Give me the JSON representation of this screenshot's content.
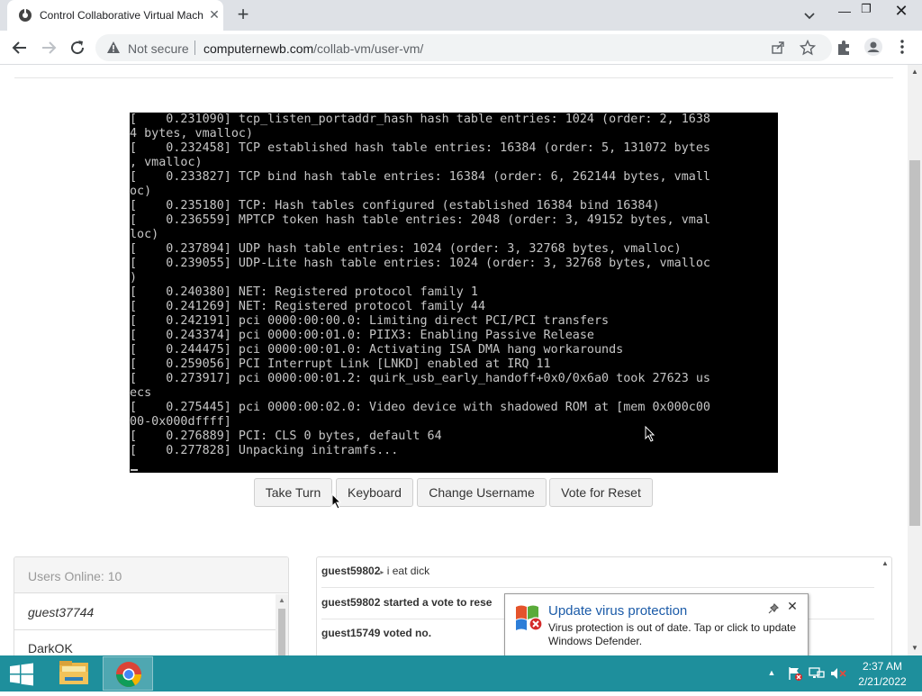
{
  "browser": {
    "tab_title": "Control Collaborative Virtual Machine",
    "security_label": "Not secure",
    "url_host": "computernewb.com",
    "url_path": "/collab-vm/user-vm/"
  },
  "console": {
    "lines": [
      "[    0.231090] tcp_listen_portaddr_hash hash table entries: 1024 (order: 2, 1638",
      "4 bytes, vmalloc)",
      "[    0.232458] TCP established hash table entries: 16384 (order: 5, 131072 bytes",
      ", vmalloc)",
      "[    0.233827] TCP bind hash table entries: 16384 (order: 6, 262144 bytes, vmall",
      "oc)",
      "[    0.235180] TCP: Hash tables configured (established 16384 bind 16384)",
      "[    0.236559] MPTCP token hash table entries: 2048 (order: 3, 49152 bytes, vmal",
      "loc)",
      "[    0.237894] UDP hash table entries: 1024 (order: 3, 32768 bytes, vmalloc)",
      "[    0.239055] UDP-Lite hash table entries: 1024 (order: 3, 32768 bytes, vmalloc",
      ")",
      "[    0.240380] NET: Registered protocol family 1",
      "[    0.241269] NET: Registered protocol family 44",
      "[    0.242191] pci 0000:00:00.0: Limiting direct PCI/PCI transfers",
      "[    0.243374] pci 0000:00:01.0: PIIX3: Enabling Passive Release",
      "[    0.244475] pci 0000:00:01.0: Activating ISA DMA hang workarounds",
      "[    0.259056] PCI Interrupt Link [LNKD] enabled at IRQ 11",
      "[    0.273917] pci 0000:00:01.2: quirk_usb_early_handoff+0x0/0x6a0 took 27623 us",
      "ecs",
      "[    0.275445] pci 0000:00:02.0: Video device with shadowed ROM at [mem 0x000c00",
      "00-0x000dffff]",
      "[    0.276889] PCI: CLS 0 bytes, default 64",
      "[    0.277828] Unpacking initramfs..."
    ]
  },
  "vm_buttons": {
    "take_turn": "Take Turn",
    "keyboard": "Keyboard",
    "change_username": "Change Username",
    "vote_reset": "Vote for Reset"
  },
  "users": {
    "header": "Users Online: 10",
    "items": [
      "guest37744",
      "DarkOK"
    ]
  },
  "chat": {
    "messages": [
      {
        "name": "guest59802",
        "separator": "▸",
        "text": "i eat dick"
      },
      {
        "name": "guest59802 started a vote to rese",
        "separator": "",
        "text": ""
      },
      {
        "name": "guest15749 voted no.",
        "separator": "",
        "text": ""
      }
    ]
  },
  "toast": {
    "title": "Update virus protection",
    "body": "Virus protection is out of date. Tap or click to update Windows Defender."
  },
  "taskbar": {
    "time": "2:37 AM",
    "date": "2/21/2022"
  },
  "colors": {
    "taskbar": "#1e8f9c",
    "toast_title": "#1b5ba8",
    "console_text": "#c6c6c6"
  }
}
